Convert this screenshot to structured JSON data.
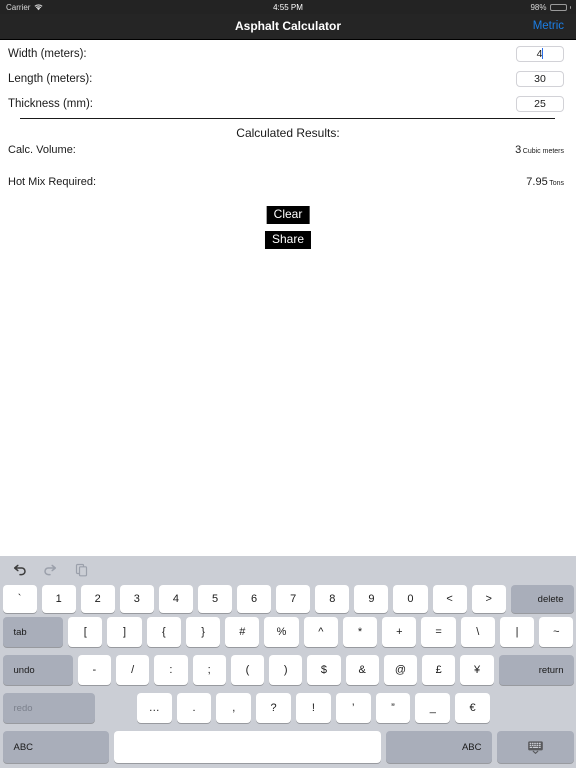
{
  "status_bar": {
    "carrier": "Carrier",
    "wifi_icon": "wifi-icon",
    "time": "4:55 PM",
    "battery_percent": "98%",
    "battery_icon": "battery-icon"
  },
  "navbar": {
    "title": "Asphalt Calculator",
    "right_action": "Metric"
  },
  "form": {
    "rows": [
      {
        "label": "Width (meters):",
        "value": "4",
        "focused": true
      },
      {
        "label": "Length (meters):",
        "value": "30",
        "focused": false
      },
      {
        "label": "Thickness (mm):",
        "value": "25",
        "focused": false
      }
    ]
  },
  "results": {
    "title": "Calculated Results:",
    "rows": [
      {
        "label": "Calc. Volume:",
        "value": "3",
        "unit": "Cubic meters"
      },
      {
        "label": "Hot Mix Required:",
        "value": "7.95",
        "unit": "Tons"
      }
    ]
  },
  "actions": {
    "clear_label": "Clear",
    "share_label": "Share"
  },
  "keyboard": {
    "toolbar": [
      {
        "name": "undo-icon",
        "enabled": true
      },
      {
        "name": "redo-icon",
        "enabled": false
      },
      {
        "name": "paste-icon",
        "enabled": false
      }
    ],
    "row1": [
      "`",
      "1",
      "2",
      "3",
      "4",
      "5",
      "6",
      "7",
      "8",
      "9",
      "0",
      "<",
      ">"
    ],
    "row1_delete": "delete",
    "row2_tab": "tab",
    "row2": [
      "[",
      "]",
      "{",
      "}",
      "#",
      "%",
      "^",
      "*",
      "+",
      "=",
      "\\",
      "|",
      "~"
    ],
    "row3_undo": "undo",
    "row3": [
      "-",
      "/",
      ":",
      ";",
      "(",
      ")",
      "$",
      "&",
      "@",
      "£",
      "¥"
    ],
    "row3_return": "return",
    "row4_redo": "redo",
    "row4": [
      "…",
      ".",
      ",",
      "?",
      "!",
      "’",
      "”",
      "_",
      "€"
    ],
    "row5_abc_left": "ABC",
    "row5_space": "",
    "row5_abc_right": "ABC",
    "row5_dismiss_icon": "keyboard-dismiss-icon"
  },
  "colors": {
    "navbar_bg": "#252525",
    "accent_blue": "#1b7ee5",
    "battery_green": "#4cd964",
    "keyboard_bg": "#cbced5",
    "key_dark": "#a9aeba"
  }
}
